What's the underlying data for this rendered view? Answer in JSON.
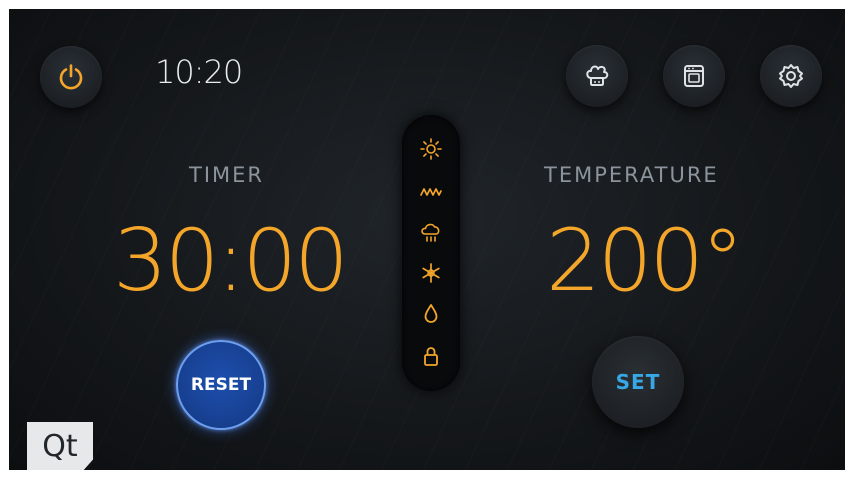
{
  "status": {
    "time": "10:20"
  },
  "icons": {
    "power": "power-icon",
    "chef": "chef-hat-icon",
    "oven": "oven-icon",
    "settings": "gear-icon"
  },
  "timer": {
    "label": "TIMER",
    "value": "30:00",
    "reset_label": "RESET"
  },
  "temperature": {
    "label": "TEMPERATURE",
    "value": "200°",
    "set_label": "SET"
  },
  "modes": [
    {
      "icon": "sun-icon"
    },
    {
      "icon": "heat-wave-icon"
    },
    {
      "icon": "rain-cloud-icon"
    },
    {
      "icon": "snowflake-icon"
    },
    {
      "icon": "water-drop-icon"
    },
    {
      "icon": "lock-icon"
    }
  ],
  "brand": {
    "logo_text": "Qt"
  },
  "colors": {
    "accent": "#f4a62a",
    "reset_blue": "#1d4fae",
    "set_blue": "#38a7e6",
    "label_gray": "#8b949c"
  }
}
